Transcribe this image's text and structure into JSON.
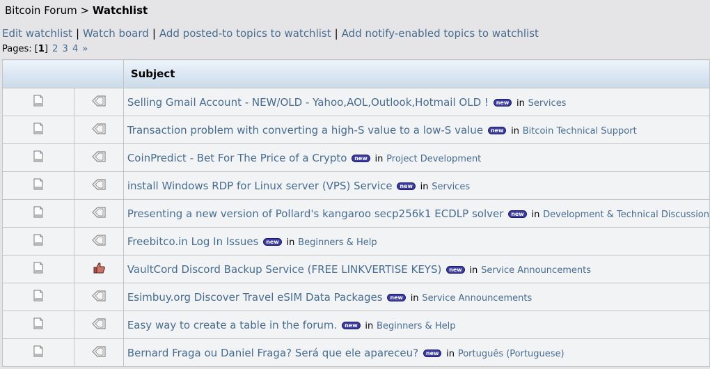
{
  "breadcrumb": {
    "forum": "Bitcoin Forum",
    "separator": ">",
    "current": "Watchlist"
  },
  "actions": [
    "Edit watchlist",
    "Watch board",
    "Add posted-to topics to watchlist",
    "Add notify-enabled topics to watchlist"
  ],
  "action_separator": "|",
  "pagination": {
    "label": "Pages:",
    "current": "1",
    "pages": [
      "2",
      "3",
      "4"
    ],
    "next": "»"
  },
  "table": {
    "subject_header": "Subject",
    "in_word": "in",
    "new_label": "new"
  },
  "topics": [
    {
      "title": "Selling Gmail Account - NEW/OLD - Yahoo,AOL,Outlook,Hotmail OLD !",
      "board": "Services",
      "icon": "xx-icon"
    },
    {
      "title": "Transaction problem with converting a high-S value to a low-S value",
      "board": "Bitcoin Technical Support",
      "icon": "xx-icon"
    },
    {
      "title": "CoinPredict - Bet For The Price of a Crypto",
      "board": "Project Development",
      "icon": "xx-icon"
    },
    {
      "title": "install Windows RDP for Linux server (VPS) Service",
      "board": "Services",
      "icon": "xx-icon"
    },
    {
      "title": "Presenting a new version of Pollard's kangaroo secp256k1 ECDLP solver",
      "board": "Development & Technical Discussion",
      "icon": "xx-icon"
    },
    {
      "title": "Freebitco.in Log In Issues",
      "board": "Beginners & Help",
      "icon": "xx-icon"
    },
    {
      "title": "VaultCord Discord Backup Service (FREE LINKVERTISE KEYS)",
      "board": "Service Announcements",
      "icon": "thumbup-icon"
    },
    {
      "title": "Esimbuy.org Discover Travel eSIM Data Packages",
      "board": "Service Announcements",
      "icon": "xx-icon"
    },
    {
      "title": "Easy way to create a table in the forum.",
      "board": "Beginners & Help",
      "icon": "xx-icon"
    },
    {
      "title": "Bernard Fraga ou Daniel Fraga? Será que ele apareceu?",
      "board": "Português (Portuguese)",
      "icon": "xx-icon"
    }
  ]
}
